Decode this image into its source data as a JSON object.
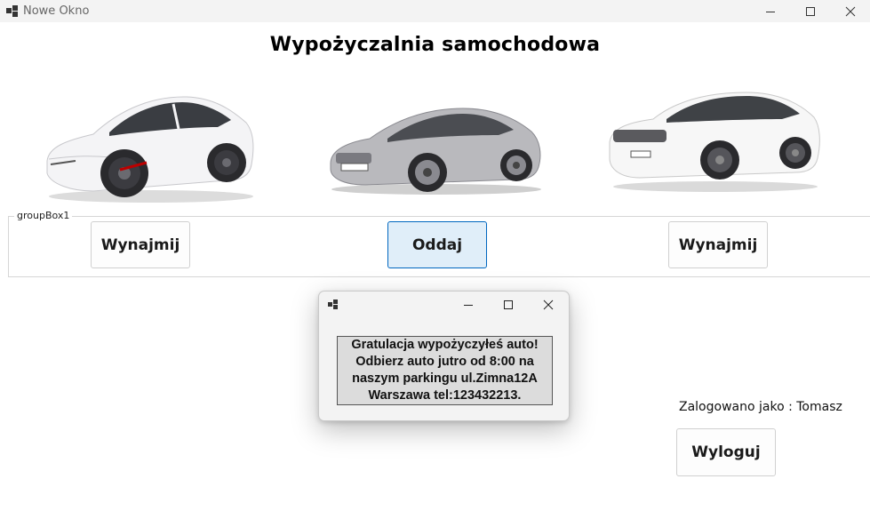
{
  "window": {
    "title": "Nowe Okno"
  },
  "main": {
    "heading": "Wypożyczalnia samochodowa",
    "cars": [
      {
        "name": "white-sedan-left",
        "body_color": "#f4f4f6"
      },
      {
        "name": "silver-coupe-center",
        "body_color": "#b9b9bd"
      },
      {
        "name": "white-sedan-right",
        "body_color": "#f7f7f7"
      }
    ],
    "group_box": {
      "label": "groupBox1",
      "buttons": [
        {
          "label": "Wynajmij"
        },
        {
          "label": "Oddaj"
        },
        {
          "label": "Wynajmij"
        }
      ]
    },
    "logged_in_label": "Zalogowano jako : Tomasz",
    "logout_button": "Wyloguj"
  },
  "dialog": {
    "message_lines": [
      "Gratulacja wypożyczyłeś auto!",
      "Odbierz auto jutro od 8:00 na",
      "naszym parkingu ul.Zimna12A",
      "Warszawa tel:123432213."
    ]
  },
  "colors": {
    "active_button_bg": "#e0eef9",
    "active_button_border": "#0067c0",
    "titlebar_bg": "#f3f3f3"
  }
}
